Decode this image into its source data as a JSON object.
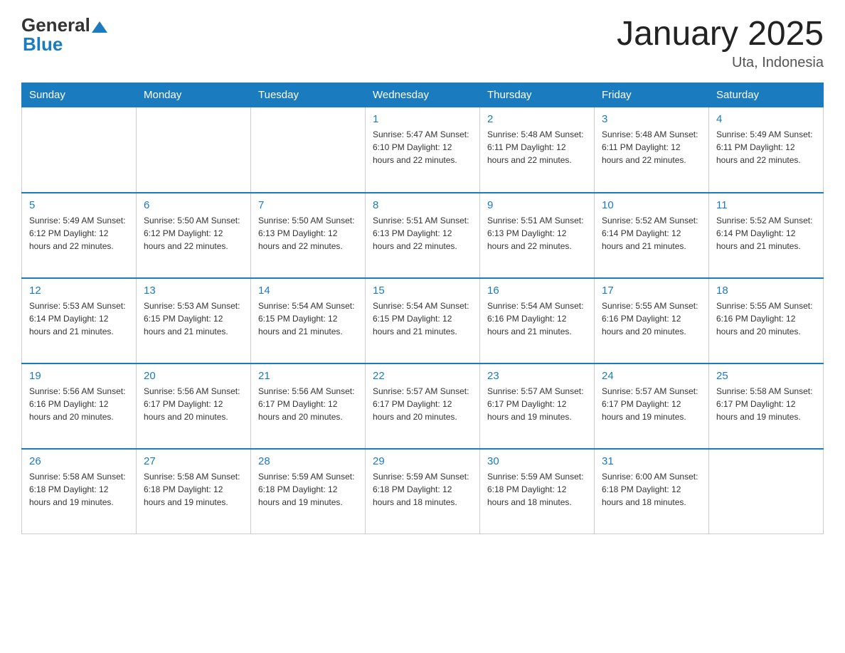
{
  "header": {
    "logo_general": "General",
    "logo_blue": "Blue",
    "title": "January 2025",
    "subtitle": "Uta, Indonesia"
  },
  "days_of_week": [
    "Sunday",
    "Monday",
    "Tuesday",
    "Wednesday",
    "Thursday",
    "Friday",
    "Saturday"
  ],
  "weeks": [
    [
      {
        "day": "",
        "info": ""
      },
      {
        "day": "",
        "info": ""
      },
      {
        "day": "",
        "info": ""
      },
      {
        "day": "1",
        "info": "Sunrise: 5:47 AM\nSunset: 6:10 PM\nDaylight: 12 hours\nand 22 minutes."
      },
      {
        "day": "2",
        "info": "Sunrise: 5:48 AM\nSunset: 6:11 PM\nDaylight: 12 hours\nand 22 minutes."
      },
      {
        "day": "3",
        "info": "Sunrise: 5:48 AM\nSunset: 6:11 PM\nDaylight: 12 hours\nand 22 minutes."
      },
      {
        "day": "4",
        "info": "Sunrise: 5:49 AM\nSunset: 6:11 PM\nDaylight: 12 hours\nand 22 minutes."
      }
    ],
    [
      {
        "day": "5",
        "info": "Sunrise: 5:49 AM\nSunset: 6:12 PM\nDaylight: 12 hours\nand 22 minutes."
      },
      {
        "day": "6",
        "info": "Sunrise: 5:50 AM\nSunset: 6:12 PM\nDaylight: 12 hours\nand 22 minutes."
      },
      {
        "day": "7",
        "info": "Sunrise: 5:50 AM\nSunset: 6:13 PM\nDaylight: 12 hours\nand 22 minutes."
      },
      {
        "day": "8",
        "info": "Sunrise: 5:51 AM\nSunset: 6:13 PM\nDaylight: 12 hours\nand 22 minutes."
      },
      {
        "day": "9",
        "info": "Sunrise: 5:51 AM\nSunset: 6:13 PM\nDaylight: 12 hours\nand 22 minutes."
      },
      {
        "day": "10",
        "info": "Sunrise: 5:52 AM\nSunset: 6:14 PM\nDaylight: 12 hours\nand 21 minutes."
      },
      {
        "day": "11",
        "info": "Sunrise: 5:52 AM\nSunset: 6:14 PM\nDaylight: 12 hours\nand 21 minutes."
      }
    ],
    [
      {
        "day": "12",
        "info": "Sunrise: 5:53 AM\nSunset: 6:14 PM\nDaylight: 12 hours\nand 21 minutes."
      },
      {
        "day": "13",
        "info": "Sunrise: 5:53 AM\nSunset: 6:15 PM\nDaylight: 12 hours\nand 21 minutes."
      },
      {
        "day": "14",
        "info": "Sunrise: 5:54 AM\nSunset: 6:15 PM\nDaylight: 12 hours\nand 21 minutes."
      },
      {
        "day": "15",
        "info": "Sunrise: 5:54 AM\nSunset: 6:15 PM\nDaylight: 12 hours\nand 21 minutes."
      },
      {
        "day": "16",
        "info": "Sunrise: 5:54 AM\nSunset: 6:16 PM\nDaylight: 12 hours\nand 21 minutes."
      },
      {
        "day": "17",
        "info": "Sunrise: 5:55 AM\nSunset: 6:16 PM\nDaylight: 12 hours\nand 20 minutes."
      },
      {
        "day": "18",
        "info": "Sunrise: 5:55 AM\nSunset: 6:16 PM\nDaylight: 12 hours\nand 20 minutes."
      }
    ],
    [
      {
        "day": "19",
        "info": "Sunrise: 5:56 AM\nSunset: 6:16 PM\nDaylight: 12 hours\nand 20 minutes."
      },
      {
        "day": "20",
        "info": "Sunrise: 5:56 AM\nSunset: 6:17 PM\nDaylight: 12 hours\nand 20 minutes."
      },
      {
        "day": "21",
        "info": "Sunrise: 5:56 AM\nSunset: 6:17 PM\nDaylight: 12 hours\nand 20 minutes."
      },
      {
        "day": "22",
        "info": "Sunrise: 5:57 AM\nSunset: 6:17 PM\nDaylight: 12 hours\nand 20 minutes."
      },
      {
        "day": "23",
        "info": "Sunrise: 5:57 AM\nSunset: 6:17 PM\nDaylight: 12 hours\nand 19 minutes."
      },
      {
        "day": "24",
        "info": "Sunrise: 5:57 AM\nSunset: 6:17 PM\nDaylight: 12 hours\nand 19 minutes."
      },
      {
        "day": "25",
        "info": "Sunrise: 5:58 AM\nSunset: 6:17 PM\nDaylight: 12 hours\nand 19 minutes."
      }
    ],
    [
      {
        "day": "26",
        "info": "Sunrise: 5:58 AM\nSunset: 6:18 PM\nDaylight: 12 hours\nand 19 minutes."
      },
      {
        "day": "27",
        "info": "Sunrise: 5:58 AM\nSunset: 6:18 PM\nDaylight: 12 hours\nand 19 minutes."
      },
      {
        "day": "28",
        "info": "Sunrise: 5:59 AM\nSunset: 6:18 PM\nDaylight: 12 hours\nand 19 minutes."
      },
      {
        "day": "29",
        "info": "Sunrise: 5:59 AM\nSunset: 6:18 PM\nDaylight: 12 hours\nand 18 minutes."
      },
      {
        "day": "30",
        "info": "Sunrise: 5:59 AM\nSunset: 6:18 PM\nDaylight: 12 hours\nand 18 minutes."
      },
      {
        "day": "31",
        "info": "Sunrise: 6:00 AM\nSunset: 6:18 PM\nDaylight: 12 hours\nand 18 minutes."
      },
      {
        "day": "",
        "info": ""
      }
    ]
  ]
}
